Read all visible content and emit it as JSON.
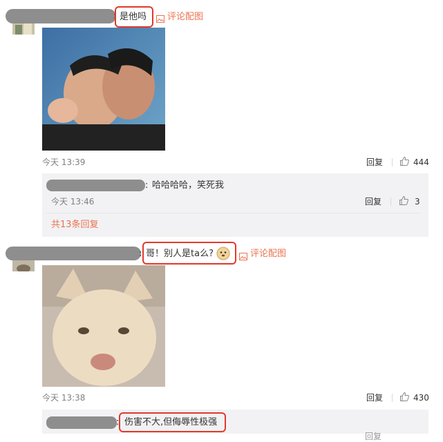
{
  "comment1": {
    "text": "是他吗",
    "image_link": "评论配图",
    "time": "今天 13:39",
    "reply_label": "回复",
    "like_count": "444"
  },
  "subreply1": {
    "text": "哈哈哈哈，笑死我",
    "time": "今天 13:46",
    "reply_label": "回复",
    "like_count": "3"
  },
  "more_replies": "共13条回复",
  "comment2": {
    "text": "哥！别人是ta么?",
    "image_link": "评论配图",
    "time": "今天 13:38",
    "reply_label": "回复",
    "like_count": "430"
  },
  "subreply2": {
    "text": "伤害不大,但侮辱性极强",
    "reply_label": "回复"
  },
  "colors": {
    "highlight": "#e2382b",
    "link": "#eb7350",
    "reply_bg": "#f2f2f5"
  }
}
